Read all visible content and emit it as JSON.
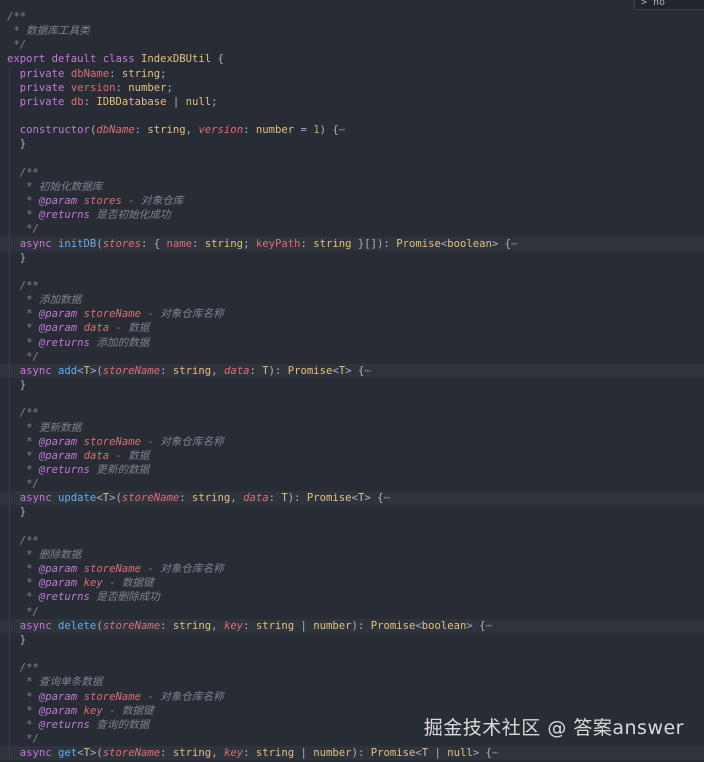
{
  "hover_tip": "> no",
  "watermark": "掘金技术社区 @ 答案answer",
  "code_lines": [
    {
      "tokens": [
        [
          "cm",
          "/**"
        ]
      ]
    },
    {
      "tokens": [
        [
          "cm",
          " * 数据库工具类"
        ]
      ]
    },
    {
      "tokens": [
        [
          "cm",
          " */"
        ]
      ]
    },
    {
      "tokens": [
        [
          "kw",
          "export"
        ],
        [
          "pu",
          " "
        ],
        [
          "kw",
          "default"
        ],
        [
          "pu",
          " "
        ],
        [
          "kw",
          "class"
        ],
        [
          "pu",
          " "
        ],
        [
          "ty",
          "IndexDBUtil"
        ],
        [
          "pu",
          " {"
        ]
      ]
    },
    {
      "tokens": [
        [
          "pu",
          "  "
        ],
        [
          "kw",
          "private"
        ],
        [
          "pu",
          " "
        ],
        [
          "pl",
          "dbName"
        ],
        [
          "pu",
          ": "
        ],
        [
          "ty",
          "string"
        ],
        [
          "pu",
          ";"
        ]
      ]
    },
    {
      "tokens": [
        [
          "pu",
          "  "
        ],
        [
          "kw",
          "private"
        ],
        [
          "pu",
          " "
        ],
        [
          "pl",
          "version"
        ],
        [
          "pu",
          ": "
        ],
        [
          "ty",
          "number"
        ],
        [
          "pu",
          ";"
        ]
      ]
    },
    {
      "tokens": [
        [
          "pu",
          "  "
        ],
        [
          "kw",
          "private"
        ],
        [
          "pu",
          " "
        ],
        [
          "pl",
          "db"
        ],
        [
          "pu",
          ": "
        ],
        [
          "ty",
          "IDBDatabase"
        ],
        [
          "pu",
          " | "
        ],
        [
          "ty",
          "null"
        ],
        [
          "pu",
          ";"
        ]
      ]
    },
    {
      "tokens": []
    },
    {
      "tokens": [
        [
          "pu",
          "  "
        ],
        [
          "kw",
          "constructor"
        ],
        [
          "pu",
          "("
        ],
        [
          "pl it",
          "dbName"
        ],
        [
          "pu",
          ": "
        ],
        [
          "ty",
          "string"
        ],
        [
          "pu",
          ", "
        ],
        [
          "pl it",
          "version"
        ],
        [
          "pu",
          ": "
        ],
        [
          "ty",
          "number"
        ],
        [
          "pu",
          " = "
        ],
        [
          "num",
          "1"
        ],
        [
          "pu",
          ") {"
        ],
        [
          "fold",
          "⋯"
        ]
      ]
    },
    {
      "tokens": [
        [
          "pu",
          "  }"
        ]
      ]
    },
    {
      "tokens": []
    },
    {
      "tokens": [
        [
          "cm",
          "  /**"
        ]
      ]
    },
    {
      "tokens": [
        [
          "cm",
          "   * 初始化数据库"
        ]
      ]
    },
    {
      "tokens": [
        [
          "cm",
          "   * "
        ],
        [
          "tag",
          "@param"
        ],
        [
          "cm",
          " "
        ],
        [
          "pl it",
          "stores"
        ],
        [
          "cm",
          " - 对象仓库"
        ]
      ]
    },
    {
      "tokens": [
        [
          "cm",
          "   * "
        ],
        [
          "tag",
          "@returns"
        ],
        [
          "cm",
          " 是否初始化成功"
        ]
      ]
    },
    {
      "tokens": [
        [
          "cm",
          "   */"
        ]
      ]
    },
    {
      "tokens": [
        [
          "pu",
          "  "
        ],
        [
          "kw",
          "async"
        ],
        [
          "pu",
          " "
        ],
        [
          "fn",
          "initDB"
        ],
        [
          "pu",
          "("
        ],
        [
          "pl it",
          "stores"
        ],
        [
          "pu",
          ": { "
        ],
        [
          "pl",
          "name"
        ],
        [
          "pu",
          ": "
        ],
        [
          "ty",
          "string"
        ],
        [
          "pu",
          "; "
        ],
        [
          "pl",
          "keyPath"
        ],
        [
          "pu",
          ": "
        ],
        [
          "ty",
          "string"
        ],
        [
          "pu",
          " }[]): "
        ],
        [
          "ty",
          "Promise"
        ],
        [
          "pu",
          "<"
        ],
        [
          "ty",
          "boolean"
        ],
        [
          "pu",
          "> {"
        ],
        [
          "fold",
          "⋯"
        ]
      ],
      "hl": true
    },
    {
      "tokens": [
        [
          "pu",
          "  }"
        ]
      ]
    },
    {
      "tokens": []
    },
    {
      "tokens": [
        [
          "cm",
          "  /**"
        ]
      ]
    },
    {
      "tokens": [
        [
          "cm",
          "   * 添加数据"
        ]
      ]
    },
    {
      "tokens": [
        [
          "cm",
          "   * "
        ],
        [
          "tag",
          "@param"
        ],
        [
          "cm",
          " "
        ],
        [
          "pl it",
          "storeName"
        ],
        [
          "cm",
          " - 对象仓库名称"
        ]
      ]
    },
    {
      "tokens": [
        [
          "cm",
          "   * "
        ],
        [
          "tag",
          "@param"
        ],
        [
          "cm",
          " "
        ],
        [
          "pl it",
          "data"
        ],
        [
          "cm",
          " - 数据"
        ]
      ]
    },
    {
      "tokens": [
        [
          "cm",
          "   * "
        ],
        [
          "tag",
          "@returns"
        ],
        [
          "cm",
          " 添加的数据"
        ]
      ]
    },
    {
      "tokens": [
        [
          "cm",
          "   */"
        ]
      ]
    },
    {
      "tokens": [
        [
          "pu",
          "  "
        ],
        [
          "kw",
          "async"
        ],
        [
          "pu",
          " "
        ],
        [
          "fn",
          "add"
        ],
        [
          "pu",
          "<"
        ],
        [
          "ty",
          "T"
        ],
        [
          "pu",
          ">("
        ],
        [
          "pl it",
          "storeName"
        ],
        [
          "pu",
          ": "
        ],
        [
          "ty",
          "string"
        ],
        [
          "pu",
          ", "
        ],
        [
          "pl it",
          "data"
        ],
        [
          "pu",
          ": "
        ],
        [
          "ty",
          "T"
        ],
        [
          "pu",
          "): "
        ],
        [
          "ty",
          "Promise"
        ],
        [
          "pu",
          "<"
        ],
        [
          "ty",
          "T"
        ],
        [
          "pu",
          "> {"
        ],
        [
          "fold",
          "⋯"
        ]
      ],
      "hl": true
    },
    {
      "tokens": [
        [
          "pu",
          "  }"
        ]
      ]
    },
    {
      "tokens": []
    },
    {
      "tokens": [
        [
          "cm",
          "  /**"
        ]
      ]
    },
    {
      "tokens": [
        [
          "cm",
          "   * 更新数据"
        ]
      ]
    },
    {
      "tokens": [
        [
          "cm",
          "   * "
        ],
        [
          "tag",
          "@param"
        ],
        [
          "cm",
          " "
        ],
        [
          "pl it",
          "storeName"
        ],
        [
          "cm",
          " - 对象仓库名称"
        ]
      ]
    },
    {
      "tokens": [
        [
          "cm",
          "   * "
        ],
        [
          "tag",
          "@param"
        ],
        [
          "cm",
          " "
        ],
        [
          "pl it",
          "data"
        ],
        [
          "cm",
          " - 数据"
        ]
      ]
    },
    {
      "tokens": [
        [
          "cm",
          "   * "
        ],
        [
          "tag",
          "@returns"
        ],
        [
          "cm",
          " 更新的数据"
        ]
      ]
    },
    {
      "tokens": [
        [
          "cm",
          "   */"
        ]
      ]
    },
    {
      "tokens": [
        [
          "pu",
          "  "
        ],
        [
          "kw",
          "async"
        ],
        [
          "pu",
          " "
        ],
        [
          "fn",
          "update"
        ],
        [
          "pu",
          "<"
        ],
        [
          "ty",
          "T"
        ],
        [
          "pu",
          ">("
        ],
        [
          "pl it",
          "storeName"
        ],
        [
          "pu",
          ": "
        ],
        [
          "ty",
          "string"
        ],
        [
          "pu",
          ", "
        ],
        [
          "pl it",
          "data"
        ],
        [
          "pu",
          ": "
        ],
        [
          "ty",
          "T"
        ],
        [
          "pu",
          "): "
        ],
        [
          "ty",
          "Promise"
        ],
        [
          "pu",
          "<"
        ],
        [
          "ty",
          "T"
        ],
        [
          "pu",
          "> {"
        ],
        [
          "fold",
          "⋯"
        ]
      ],
      "hl": true
    },
    {
      "tokens": [
        [
          "pu",
          "  }"
        ]
      ]
    },
    {
      "tokens": []
    },
    {
      "tokens": [
        [
          "cm",
          "  /**"
        ]
      ]
    },
    {
      "tokens": [
        [
          "cm",
          "   * 删除数据"
        ]
      ]
    },
    {
      "tokens": [
        [
          "cm",
          "   * "
        ],
        [
          "tag",
          "@param"
        ],
        [
          "cm",
          " "
        ],
        [
          "pl it",
          "storeName"
        ],
        [
          "cm",
          " - 对象仓库名称"
        ]
      ]
    },
    {
      "tokens": [
        [
          "cm",
          "   * "
        ],
        [
          "tag",
          "@param"
        ],
        [
          "cm",
          " "
        ],
        [
          "pl it",
          "key"
        ],
        [
          "cm",
          " - 数据键"
        ]
      ]
    },
    {
      "tokens": [
        [
          "cm",
          "   * "
        ],
        [
          "tag",
          "@returns"
        ],
        [
          "cm",
          " 是否删除成功"
        ]
      ]
    },
    {
      "tokens": [
        [
          "cm",
          "   */"
        ]
      ]
    },
    {
      "tokens": [
        [
          "pu",
          "  "
        ],
        [
          "kw",
          "async"
        ],
        [
          "pu",
          " "
        ],
        [
          "fn",
          "delete"
        ],
        [
          "pu",
          "("
        ],
        [
          "pl it",
          "storeName"
        ],
        [
          "pu",
          ": "
        ],
        [
          "ty",
          "string"
        ],
        [
          "pu",
          ", "
        ],
        [
          "pl it",
          "key"
        ],
        [
          "pu",
          ": "
        ],
        [
          "ty",
          "string"
        ],
        [
          "pu",
          " | "
        ],
        [
          "ty",
          "number"
        ],
        [
          "pu",
          "): "
        ],
        [
          "ty",
          "Promise"
        ],
        [
          "pu",
          "<"
        ],
        [
          "ty",
          "boolean"
        ],
        [
          "pu",
          "> {"
        ],
        [
          "fold",
          "⋯"
        ]
      ],
      "hl": true
    },
    {
      "tokens": [
        [
          "pu",
          "  }"
        ]
      ]
    },
    {
      "tokens": []
    },
    {
      "tokens": [
        [
          "cm",
          "  /**"
        ]
      ]
    },
    {
      "tokens": [
        [
          "cm",
          "   * 查询单条数据"
        ]
      ]
    },
    {
      "tokens": [
        [
          "cm",
          "   * "
        ],
        [
          "tag",
          "@param"
        ],
        [
          "cm",
          " "
        ],
        [
          "pl it",
          "storeName"
        ],
        [
          "cm",
          " - 对象仓库名称"
        ]
      ]
    },
    {
      "tokens": [
        [
          "cm",
          "   * "
        ],
        [
          "tag",
          "@param"
        ],
        [
          "cm",
          " "
        ],
        [
          "pl it",
          "key"
        ],
        [
          "cm",
          " - 数据键"
        ]
      ]
    },
    {
      "tokens": [
        [
          "cm",
          "   * "
        ],
        [
          "tag",
          "@returns"
        ],
        [
          "cm",
          " 查询的数据"
        ]
      ]
    },
    {
      "tokens": [
        [
          "cm",
          "   */"
        ]
      ]
    },
    {
      "tokens": [
        [
          "pu",
          "  "
        ],
        [
          "kw",
          "async"
        ],
        [
          "pu",
          " "
        ],
        [
          "fn",
          "get"
        ],
        [
          "pu",
          "<"
        ],
        [
          "ty",
          "T"
        ],
        [
          "pu",
          ">("
        ],
        [
          "pl it",
          "storeName"
        ],
        [
          "pu",
          ": "
        ],
        [
          "ty",
          "string"
        ],
        [
          "pu",
          ", "
        ],
        [
          "pl it",
          "key"
        ],
        [
          "pu",
          ": "
        ],
        [
          "ty",
          "string"
        ],
        [
          "pu",
          " | "
        ],
        [
          "ty",
          "number"
        ],
        [
          "pu",
          "): "
        ],
        [
          "ty",
          "Promise"
        ],
        [
          "pu",
          "<"
        ],
        [
          "ty",
          "T"
        ],
        [
          "pu",
          " | "
        ],
        [
          "ty",
          "null"
        ],
        [
          "pu",
          "> {"
        ],
        [
          "fold",
          "⋯"
        ]
      ],
      "hl": true
    }
  ]
}
